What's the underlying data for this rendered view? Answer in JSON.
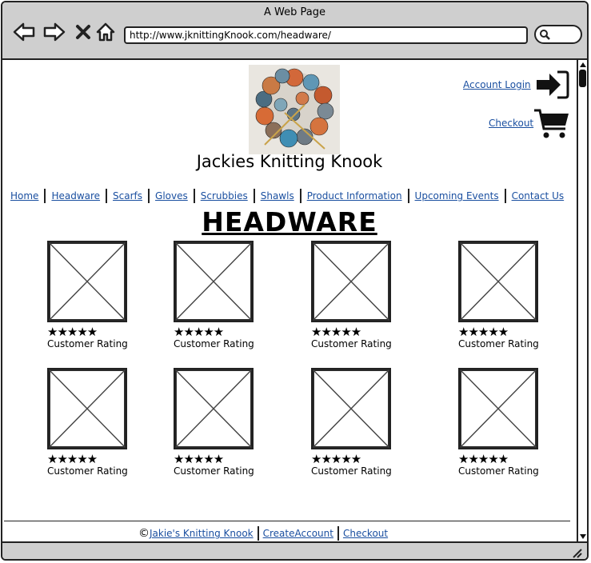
{
  "window": {
    "title": "A Web Page"
  },
  "browser": {
    "url": "http://www.jknittingKnook.com/headware/"
  },
  "header": {
    "account_login": "Account Login",
    "checkout": "Checkout",
    "brand": "Jackies Knitting Knook"
  },
  "nav": {
    "items": [
      "Home",
      "Headware",
      "Scarfs",
      "Gloves",
      "Scrubbies",
      "Shawls",
      "Product Information",
      "Upcoming Events",
      "Contact Us"
    ]
  },
  "page": {
    "heading": "HEADWARE"
  },
  "products": [
    {
      "stars": "★★★★★",
      "rating_label": "Customer Rating"
    },
    {
      "stars": "★★★★★",
      "rating_label": "Customer Rating"
    },
    {
      "stars": "★★★★★",
      "rating_label": "Customer Rating"
    },
    {
      "stars": "★★★★★",
      "rating_label": "Customer Rating"
    },
    {
      "stars": "★★★★★",
      "rating_label": "Customer Rating"
    },
    {
      "stars": "★★★★★",
      "rating_label": "Customer Rating"
    },
    {
      "stars": "★★★★★",
      "rating_label": "Customer Rating"
    },
    {
      "stars": "★★★★★",
      "rating_label": "Customer Rating"
    }
  ],
  "footer": {
    "copyright_symbol": "©",
    "site_link": "Jakie's Knitting Knook",
    "create_account": "CreateAccount",
    "checkout": "Checkout"
  },
  "colors": {
    "link": "#1a4fa0",
    "chrome": "#cfcfcf"
  },
  "icons": [
    "back-arrow-icon",
    "forward-arrow-icon",
    "close-icon",
    "home-icon",
    "search-icon",
    "login-icon",
    "cart-icon",
    "resize-grip-icon"
  ]
}
